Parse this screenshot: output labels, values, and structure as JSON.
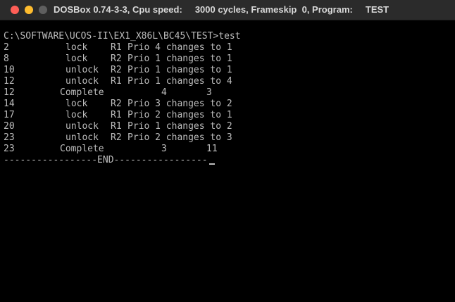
{
  "window": {
    "title": "DOSBox 0.74-3-3, Cpu speed:     3000 cycles, Frameskip  0, Program:     TEST"
  },
  "console": {
    "prompt_line": "C:\\SOFTWARE\\UCOS-II\\EX1_X86L\\BC45\\TEST>test",
    "rows": [
      {
        "t": "2",
        "action": "lock",
        "res": "R1",
        "info": "Prio 4 changes to 1"
      },
      {
        "t": "8",
        "action": "lock",
        "res": "R2",
        "info": "Prio 1 changes to 1"
      },
      {
        "t": "10",
        "action": "unlock",
        "res": "R2",
        "info": "Prio 1 changes to 1"
      },
      {
        "t": "12",
        "action": "unlock",
        "res": "R1",
        "info": "Prio 1 changes to 4"
      },
      {
        "t": "12",
        "complete": "Complete",
        "a": "4",
        "b": "3"
      },
      {
        "t": "14",
        "action": "lock",
        "res": "R2",
        "info": "Prio 3 changes to 2"
      },
      {
        "t": "17",
        "action": "lock",
        "res": "R1",
        "info": "Prio 2 changes to 1"
      },
      {
        "t": "20",
        "action": "unlock",
        "res": "R1",
        "info": "Prio 1 changes to 2"
      },
      {
        "t": "23",
        "action": "unlock",
        "res": "R2",
        "info": "Prio 2 changes to 3"
      },
      {
        "t": "23",
        "complete": "Complete",
        "a": "3",
        "b": "11"
      }
    ],
    "end_line": "-----------------END-----------------"
  }
}
